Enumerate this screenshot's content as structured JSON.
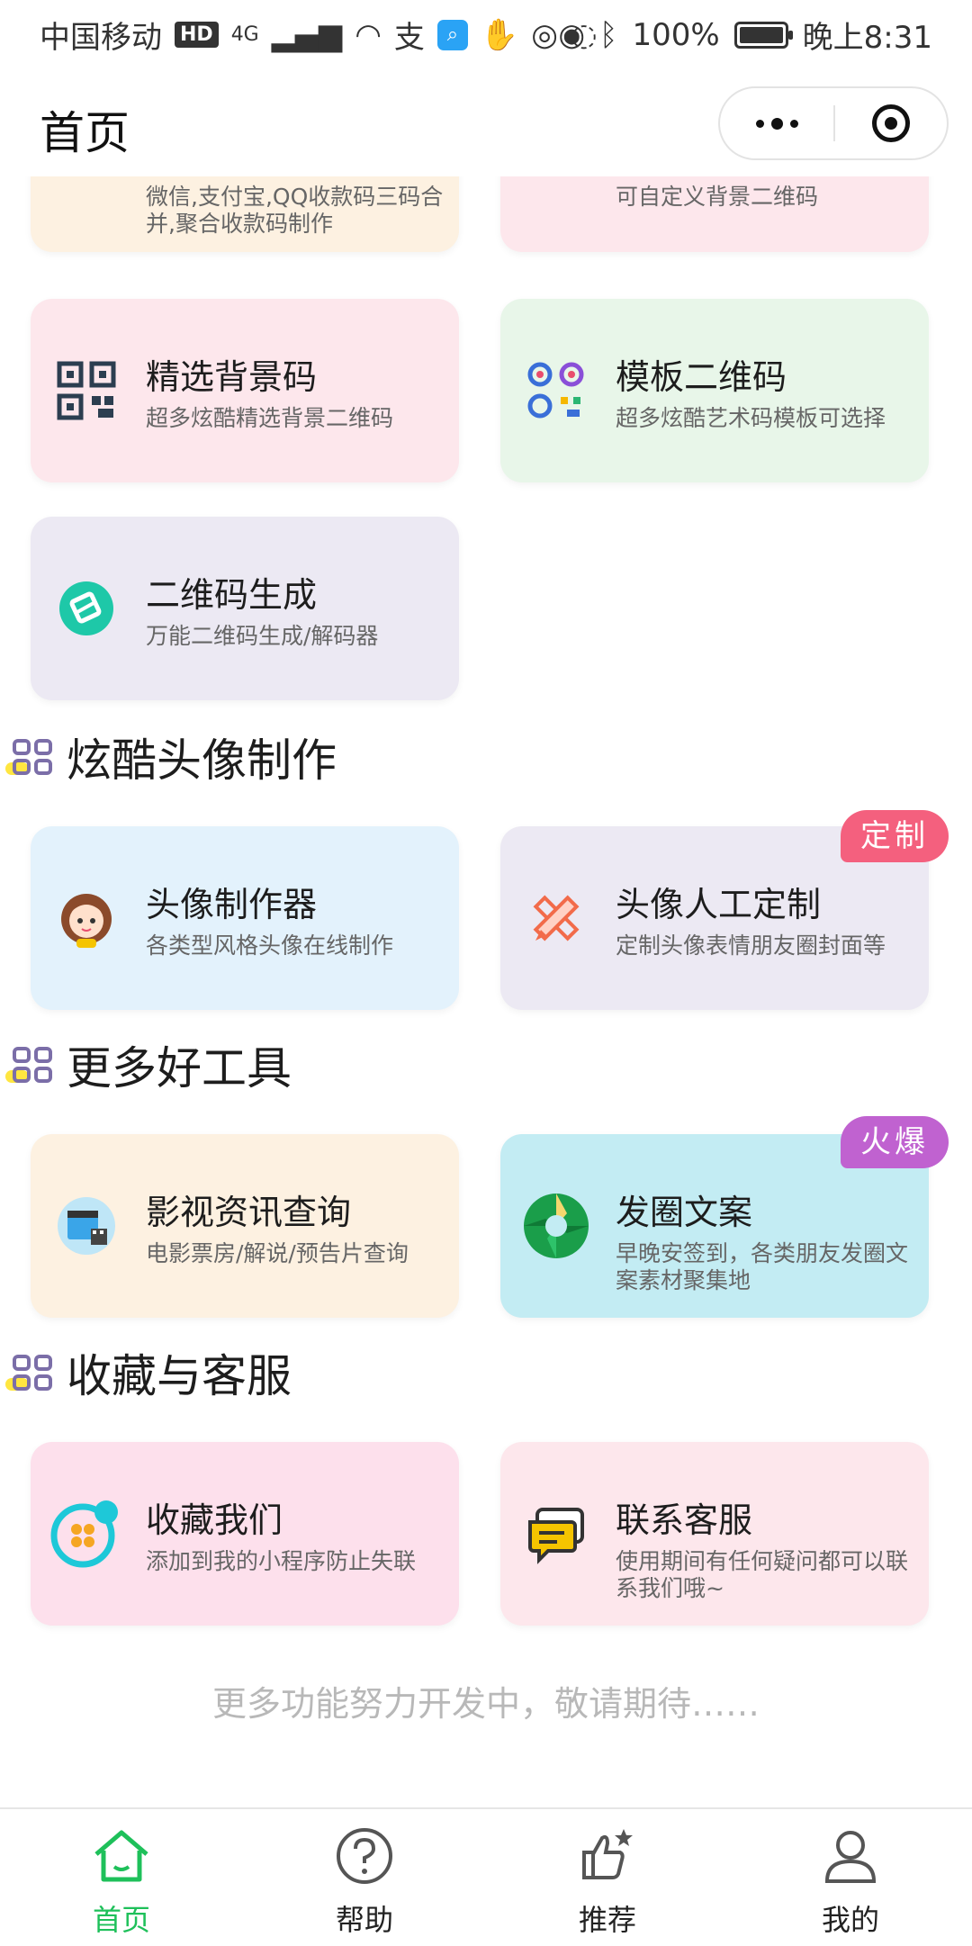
{
  "status_bar": {
    "carrier": "中国移动",
    "network_badge": "HD",
    "signal": "4G",
    "alipay_glyph": "支",
    "battery": "100%",
    "time": "晚上8:31"
  },
  "header": {
    "title": "首页"
  },
  "cards": {
    "merged_pay": {
      "desc": "微信,支付宝,QQ收款码三码合并,聚合收款码制作",
      "icon": "wallet-icon"
    },
    "custom_bg": {
      "desc": "可自定义背景二维码",
      "icon": "qr-frame-icon"
    },
    "selected_bg": {
      "title": "精选背景码",
      "desc": "超多炫酷精选背景二维码",
      "icon": "qr-code-icon"
    },
    "template_qr": {
      "title": "模板二维码",
      "desc": "超多炫酷艺术码模板可选择",
      "icon": "color-qr-icon"
    },
    "qr_gen": {
      "title": "二维码生成",
      "desc": "万能二维码生成/解码器",
      "icon": "qr-gen-icon"
    },
    "avatar_maker": {
      "title": "头像制作器",
      "desc": "各类型风格头像在线制作",
      "icon": "avatar-girl-icon"
    },
    "avatar_custom": {
      "title": "头像人工定制",
      "desc": "定制头像表情朋友圈封面等",
      "badge": "定制",
      "icon": "pencil-ruler-icon"
    },
    "movie": {
      "title": "影视资讯查询",
      "desc": "电影票房/解说/预告片查询",
      "icon": "film-icon"
    },
    "moments": {
      "title": "发圈文案",
      "desc": "早晚安签到，各类朋友发圈文案素材聚集地",
      "badge": "火爆",
      "icon": "camera-shutter-icon"
    },
    "favorite": {
      "title": "收藏我们",
      "desc": "添加到我的小程序防止失联",
      "icon": "favorite-icon"
    },
    "service": {
      "title": "联系客服",
      "desc": "使用期间有任何疑问都可以联系我们哦~",
      "icon": "chat-icon"
    }
  },
  "sections": {
    "avatar": "炫酷头像制作",
    "tools": "更多好工具",
    "favorites": "收藏与客服"
  },
  "footer_note": "更多功能努力开发中，敬请期待……",
  "tabbar": {
    "items": [
      {
        "label": "首页",
        "icon": "home-icon",
        "active": true
      },
      {
        "label": "帮助",
        "icon": "help-icon",
        "active": false
      },
      {
        "label": "推荐",
        "icon": "thumbs-up-icon",
        "active": false
      },
      {
        "label": "我的",
        "icon": "user-icon",
        "active": false
      }
    ]
  },
  "colors": {
    "accent": "#1ec05a",
    "badge_custom": "#f4607e",
    "badge_hot": "#c062d0",
    "card_peach": "#fdf1e1",
    "card_pink": "#fde7ec",
    "card_green": "#e8f6e9",
    "card_lavender": "#ece9f3",
    "card_blue": "#e3f2fc",
    "card_cyan": "#c3ecf3"
  }
}
